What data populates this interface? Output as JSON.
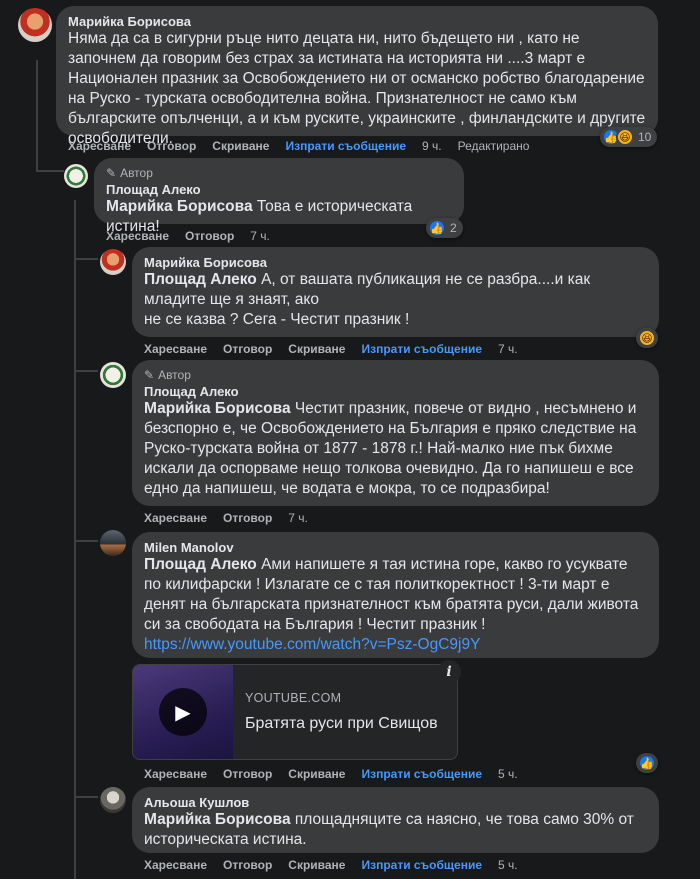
{
  "actions": {
    "like": "Харесване",
    "reply": "Отговор",
    "hide": "Скриване",
    "send_message": "Изпрати съобщение"
  },
  "author_badge": "Автор",
  "comments": [
    {
      "author": "Марийка Борисова",
      "text": "Няма да са в сигурни ръце нито децата ни, нито бъдещето ни , като не започнем да говорим без страх за истината на историята ни ....3 март е Национален празник за Освобождението ни от османско робство благодарение на Руско - турската освободителна война. Признателност не само към българските опълченци, а и към руските, украинските , финландските и другите освободители.",
      "time": "9 ч.",
      "edited": "Редактирано",
      "reactions": "10"
    },
    {
      "author": "Площад Алеко",
      "mention": "Марийка Борисова",
      "text": " Това е историческата истина!",
      "time": "7 ч.",
      "reactions": "2"
    },
    {
      "author": "Марийка Борисова",
      "mention": "Площад Алеко",
      "text_line1": " А, от вашата публикация не се разбра....и как младите ще я знаят, ако",
      "text_line2": "не се казва ? Сега - Честит празник !",
      "time": "7 ч."
    },
    {
      "author": "Площад Алеко",
      "mention": "Марийка Борисова",
      "text": " Честит празник, повече от видно , несъмнено и безспорно е, че Освобождението на България е пряко следствие на Руско-турската война от 1877 - 1878 г.! Най-малко ние пък бихме искали да оспорваме нещо толкова очевидно. Да го напишеш е все едно да напишеш, че водата е мокра, то се подразбира!",
      "time": "7 ч."
    },
    {
      "author": "Milen Manolov",
      "mention": "Площад Алеко",
      "text": " Ами напишете я тая истина горе, какво го усуквате по килифарски ! Излагате се с тая политкоректност ! 3-ти март е денят на българската признателност към братята руси, дали живота си за свободата на България ! Честит празник ! ",
      "link": "https://www.youtube.com/watch?v=Psz-OgC9j9Y",
      "time": "5 ч.",
      "preview": {
        "domain": "YOUTUBE.COM",
        "title": "Братята руси при Свищов"
      }
    },
    {
      "author": "Альоша Кушлов",
      "mention": "Марийка Борисова",
      "text": " площадняците са наясно, че това само 30% от историческата истина.",
      "time": "5 ч."
    }
  ]
}
